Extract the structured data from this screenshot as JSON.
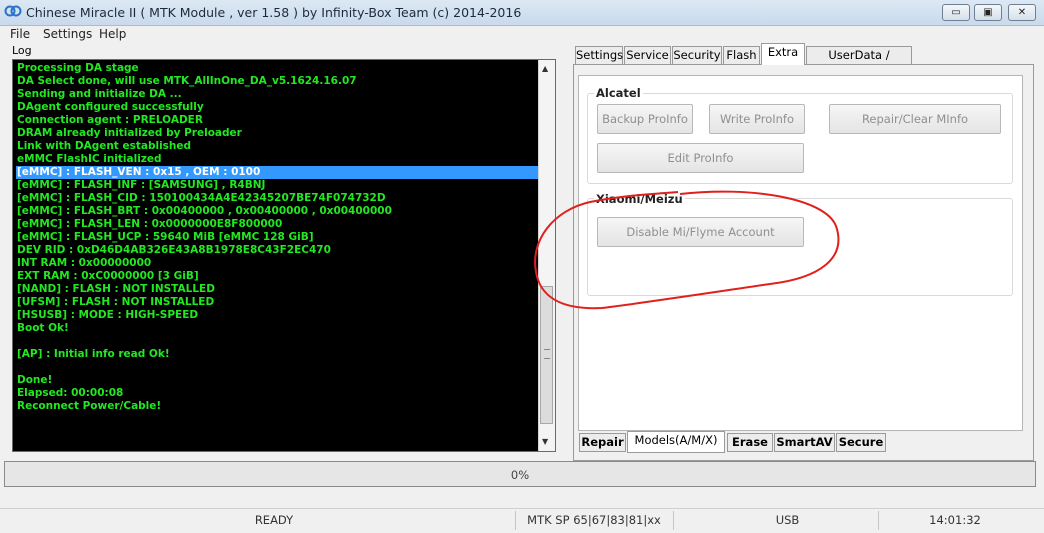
{
  "window": {
    "title": "Chinese Miracle II ( MTK Module , ver 1.58 ) by Infinity-Box Team (c) 2014-2016",
    "minimize_glyph": "▭",
    "maximize_glyph": "▣",
    "close_glyph": "✕"
  },
  "menu": [
    "File",
    "Settings",
    "Help"
  ],
  "log": {
    "label": "Log",
    "text_color": "#22e822",
    "selected_index": 8,
    "lines": [
      "Processing DA stage",
      "DA Select done, will use MTK_AllInOne_DA_v5.1624.16.07",
      "Sending and initialize DA ...",
      "DAgent configured successfully",
      "Connection agent : PRELOADER",
      "DRAM already initialized by Preloader",
      "Link with DAgent established",
      "eMMC FlashIC initialized",
      "[eMMC] : FLASH_VEN : 0x15 , OEM : 0100",
      "[eMMC] : FLASH_INF : [SAMSUNG] , R4BNJ",
      "[eMMC] : FLASH_CID : 150100434A4E42345207BE74F074732D",
      "[eMMC] : FLASH_BRT : 0x00400000 , 0x00400000 , 0x00400000",
      "[eMMC] : FLASH_LEN : 0x0000000E8F800000",
      "[eMMC] : FLASH_UCP : 59640 MiB [eMMC 128 GiB]",
      "DEV RID    : 0xD46D4AB326E43A8B1978E8C43F2EC470",
      "INT RAM    : 0x00000000",
      "EXT RAM    : 0xC0000000 [3 GiB]",
      "[NAND] : FLASH : NOT INSTALLED",
      "[UFSM] : FLASH : NOT INSTALLED",
      "[HSUSB] : MODE : HIGH-SPEED",
      "Boot Ok!",
      "",
      "[AP] : Initial info read Ok!",
      "",
      "Done!",
      "Elapsed: 00:00:08",
      "Reconnect Power/Cable!"
    ]
  },
  "top_tabs": [
    "Settings",
    "Service",
    "Security",
    "Flash",
    "Extra",
    "UserData / Forensic"
  ],
  "top_tab_active": "Extra",
  "alcatel": {
    "title": "Alcatel",
    "backup": "Backup ProInfo",
    "write": "Write ProInfo",
    "repair": "Repair/Clear MInfo",
    "edit": "Edit ProInfo"
  },
  "xiaomi": {
    "title": "Xiaomi/Meizu",
    "disable": "Disable Mi/Flyme Account"
  },
  "bottom_tabs": [
    "Repair",
    "Models(A/M/X)",
    "Erase",
    "SmartAV",
    "Secure"
  ],
  "bottom_tab_active": "Models(A/M/X)",
  "progress": {
    "text": "0%",
    "value": 0
  },
  "status": {
    "state": "READY",
    "device": "MTK SP 65|67|83|81|xx",
    "connection": "USB",
    "time": "14:01:32"
  },
  "colors": {
    "annotation_circle": "#e0201c",
    "selection": "#3399ff"
  }
}
